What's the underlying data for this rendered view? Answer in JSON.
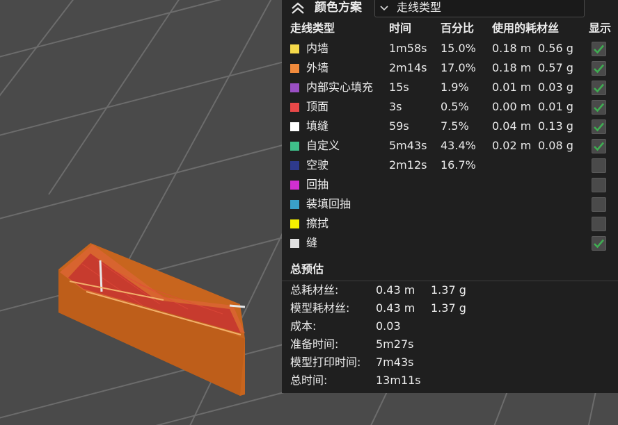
{
  "header": {
    "color_scheme_label": "颜色方案",
    "view_type": "走线类型"
  },
  "columns": {
    "type": "走线类型",
    "time": "时间",
    "percent": "百分比",
    "filament": "使用的耗材丝",
    "show": "显示"
  },
  "rows": [
    {
      "name": "内墙",
      "color": "#f5d94a",
      "time": "1m58s",
      "percent": "15.0%",
      "length": "0.18 m",
      "weight": "0.56 g",
      "checked": true
    },
    {
      "name": "外墙",
      "color": "#f08a3c",
      "time": "2m14s",
      "percent": "17.0%",
      "length": "0.18 m",
      "weight": "0.57 g",
      "checked": true
    },
    {
      "name": "内部实心填充",
      "color": "#9a4fc4",
      "time": "15s",
      "percent": "1.9%",
      "length": "0.01 m",
      "weight": "0.03 g",
      "checked": true
    },
    {
      "name": "顶面",
      "color": "#e84848",
      "time": "3s",
      "percent": "0.5%",
      "length": "0.00 m",
      "weight": "0.01 g",
      "checked": true
    },
    {
      "name": "填缝",
      "color": "#ffffff",
      "time": "59s",
      "percent": "7.5%",
      "length": "0.04 m",
      "weight": "0.13 g",
      "checked": true
    },
    {
      "name": "自定义",
      "color": "#3fbf8a",
      "time": "5m43s",
      "percent": "43.4%",
      "length": "0.02 m",
      "weight": "0.08 g",
      "checked": true
    },
    {
      "name": "空驶",
      "color": "#2e3a8c",
      "time": "2m12s",
      "percent": "16.7%",
      "length": "",
      "weight": "",
      "checked": false
    },
    {
      "name": "回抽",
      "color": "#d12fd1",
      "time": "",
      "percent": "",
      "length": "",
      "weight": "",
      "checked": false
    },
    {
      "name": "装填回抽",
      "color": "#3aa0c8",
      "time": "",
      "percent": "",
      "length": "",
      "weight": "",
      "checked": false
    },
    {
      "name": "擦拭",
      "color": "#f5f000",
      "time": "",
      "percent": "",
      "length": "",
      "weight": "",
      "checked": false
    },
    {
      "name": "缝",
      "color": "#e0e0e0",
      "time": "",
      "percent": "",
      "length": "",
      "weight": "",
      "checked": true
    }
  ],
  "summary": {
    "title": "总预估",
    "rows": [
      {
        "label": "总耗材丝:",
        "v1": "0.43 m",
        "v2": "1.37 g"
      },
      {
        "label": "模型耗材丝:",
        "v1": "0.43 m",
        "v2": "1.37 g"
      },
      {
        "label": "成本:",
        "v1": "0.03",
        "v2": ""
      },
      {
        "label": "准备时间:",
        "v1": "5m27s",
        "v2": ""
      },
      {
        "label": "模型打印时间:",
        "v1": "7m43s",
        "v2": ""
      },
      {
        "label": "总时间:",
        "v1": "13m11s",
        "v2": ""
      }
    ]
  },
  "colors": {
    "panel_bg": "#1f1f1f",
    "viewport_bg": "#4b4b4b",
    "grid_line": "#6e6e6e",
    "check_green": "#2f9e44",
    "model_orange": "#c8651e"
  },
  "icons": {
    "collapse": "double-chevron-up-icon",
    "dropdown": "chevron-down-icon",
    "check": "checkmark-icon"
  }
}
